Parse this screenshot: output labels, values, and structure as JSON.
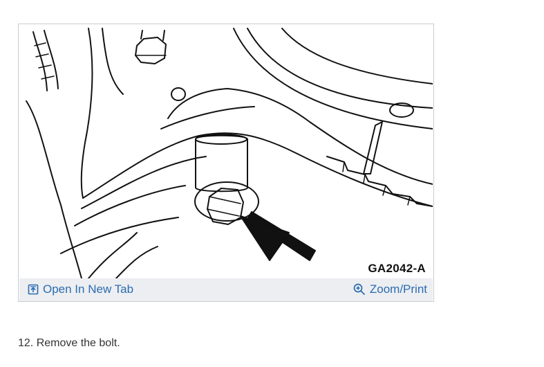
{
  "figure": {
    "code": "GA2042-A",
    "alt_subject": "bolt-location-diagram"
  },
  "toolbar": {
    "open_label": "Open In New Tab",
    "open_icon": "open-new-tab-icon",
    "zoom_label": "Zoom/Print",
    "zoom_icon": "zoom-icon"
  },
  "step": {
    "text": "12. Remove the bolt."
  },
  "colors": {
    "link": "#2b6cb0",
    "toolbar_bg": "#eceef1",
    "border": "#c9cdd2"
  }
}
